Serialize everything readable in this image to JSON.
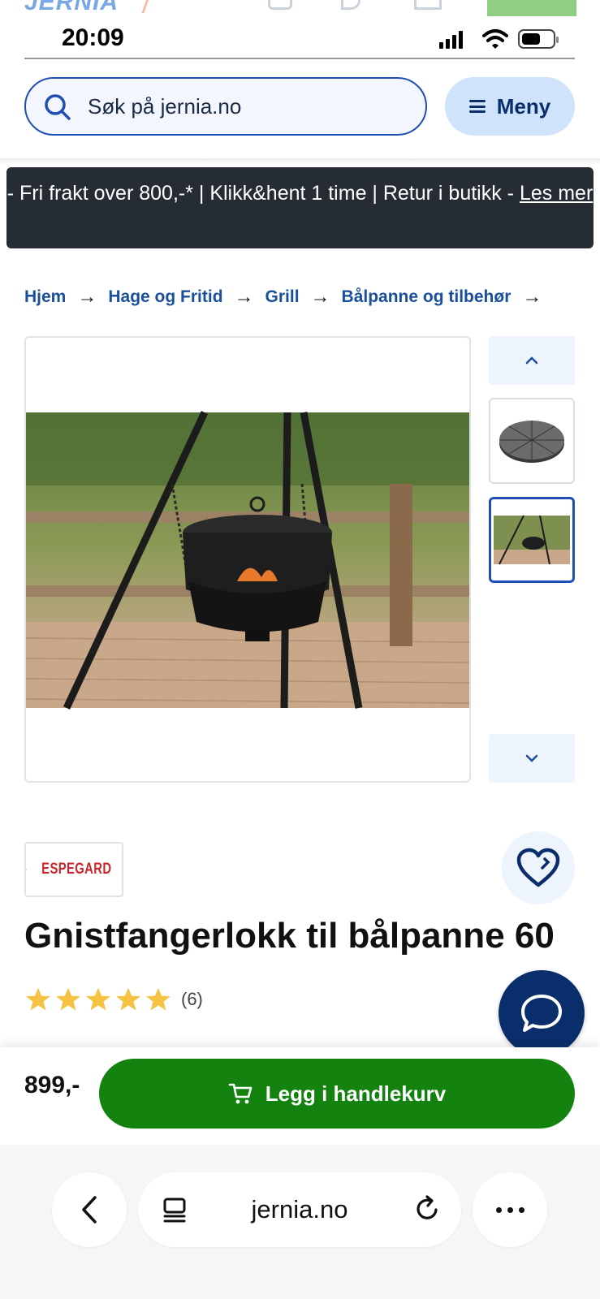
{
  "status_bar": {
    "time": "20:09"
  },
  "search": {
    "placeholder": "Søk på jernia.no"
  },
  "menu": {
    "label": "Meny"
  },
  "banner": {
    "text": "- Fri frakt over 800,-* | Klikk&hent 1 time | Retur i butikk - ",
    "link": "Les mer"
  },
  "breadcrumb": {
    "items": [
      "Hjem",
      "Hage og Fritid",
      "Grill",
      "Bålpanne og tilbehør"
    ]
  },
  "product": {
    "brand": "ESPEGARD",
    "title": "Gnistfangerlokk til bålpanne 60",
    "rating": 5,
    "review_count": "(6)",
    "price": "899,-",
    "add_to_cart": "Legg i handlekurv"
  },
  "gallery": {
    "thumbnails": [
      "spark-guard-lid",
      "fire-pit-on-tripod"
    ],
    "selected_index": 1
  },
  "browser": {
    "url": "jernia.no"
  },
  "colors": {
    "brand_blue": "#1f4fb3",
    "dark_navy": "#0a2e6b",
    "cart_green": "#14820f",
    "star_yellow": "#f5c242",
    "banner_bg": "#262c33"
  },
  "icons": {
    "search": "search-icon",
    "menu": "hamburger-icon",
    "favorite": "heart-icon",
    "chat": "chat-bubble-icon",
    "cart": "cart-icon",
    "back": "chevron-left-icon",
    "tabs": "tabs-icon",
    "reload": "reload-icon",
    "more": "more-icon"
  }
}
